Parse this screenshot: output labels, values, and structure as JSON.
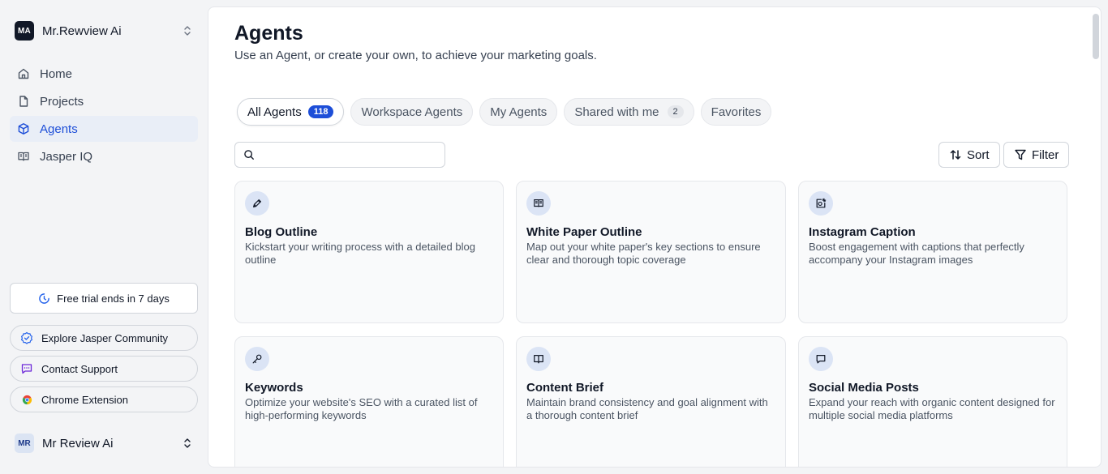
{
  "workspace": {
    "initials": "MA",
    "name": "Mr.Rewview Ai"
  },
  "nav": [
    {
      "label": "Home",
      "icon": "home-icon"
    },
    {
      "label": "Projects",
      "icon": "file-icon"
    },
    {
      "label": "Agents",
      "icon": "cube-icon",
      "active": true
    },
    {
      "label": "Jasper IQ",
      "icon": "book-icon"
    }
  ],
  "trial": {
    "label": "Free trial ends in 7 days"
  },
  "links": [
    {
      "label": "Explore Jasper Community",
      "icon": "badge-check-icon"
    },
    {
      "label": "Contact Support",
      "icon": "message-icon"
    },
    {
      "label": "Chrome Extension",
      "icon": "chrome-icon"
    }
  ],
  "user": {
    "initials": "MR",
    "name": "Mr Review Ai"
  },
  "page": {
    "title": "Agents",
    "subtitle": "Use an Agent, or create your own, to achieve your marketing goals."
  },
  "tabs": [
    {
      "label": "All Agents",
      "count": "118",
      "active": true
    },
    {
      "label": "Workspace Agents"
    },
    {
      "label": "My Agents"
    },
    {
      "label": "Shared with me",
      "count": "2"
    },
    {
      "label": "Favorites"
    }
  ],
  "search": {
    "placeholder": ""
  },
  "toolbar": {
    "sort_label": "Sort",
    "filter_label": "Filter"
  },
  "cards": [
    {
      "title": "Blog Outline",
      "desc": "Kickstart your writing process with a detailed blog outline",
      "icon": "pen-icon"
    },
    {
      "title": "White Paper Outline",
      "desc": "Map out your white paper's key sections to ensure clear and thorough topic coverage",
      "icon": "newspaper-icon"
    },
    {
      "title": "Instagram Caption",
      "desc": "Boost engagement with captions that perfectly accompany your Instagram images",
      "icon": "image-edit-icon"
    },
    {
      "title": "Keywords",
      "desc": "Optimize your website's SEO with a curated list of high-performing keywords",
      "icon": "key-icon"
    },
    {
      "title": "Content Brief",
      "desc": "Maintain brand consistency and goal alignment with a thorough content brief",
      "icon": "open-book-icon"
    },
    {
      "title": "Social Media Posts",
      "desc": "Expand your reach with organic content designed for multiple social media platforms",
      "icon": "chat-bubble-icon"
    }
  ],
  "colors": {
    "accent": "#1d4ed8",
    "active_bg": "#e9eef7",
    "card_icon_bg": "#dbe4f5"
  }
}
